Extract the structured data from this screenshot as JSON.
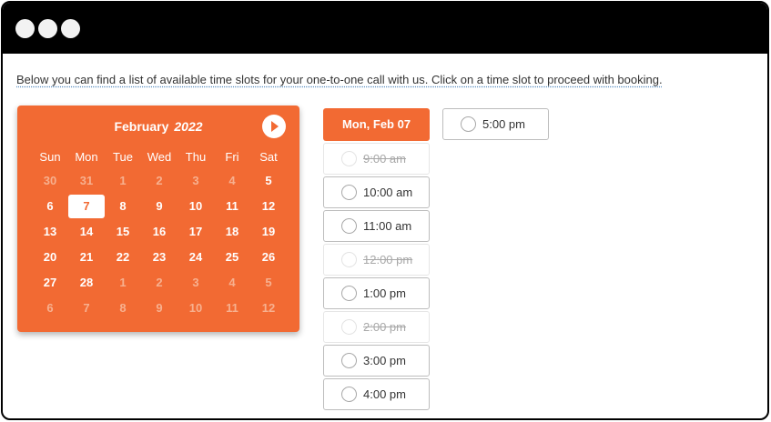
{
  "intro_text": "Below you can find a list of available time slots for your one-to-one call with us. Click on a time slot to proceed with booking.",
  "colors": {
    "accent": "#f26a33",
    "titlebar": "#000000"
  },
  "calendar": {
    "month": "February",
    "year": "2022",
    "next_icon": "chevron-right-icon",
    "weekdays": [
      "Sun",
      "Mon",
      "Tue",
      "Wed",
      "Thu",
      "Fri",
      "Sat"
    ],
    "weeks": [
      [
        {
          "d": "30",
          "o": true
        },
        {
          "d": "31",
          "o": true
        },
        {
          "d": "1",
          "o": true
        },
        {
          "d": "2",
          "o": true
        },
        {
          "d": "3",
          "o": true
        },
        {
          "d": "4",
          "o": true
        },
        {
          "d": "5",
          "o": false
        }
      ],
      [
        {
          "d": "6",
          "o": false
        },
        {
          "d": "7",
          "o": false,
          "sel": true
        },
        {
          "d": "8",
          "o": false
        },
        {
          "d": "9",
          "o": false
        },
        {
          "d": "10",
          "o": false
        },
        {
          "d": "11",
          "o": false
        },
        {
          "d": "12",
          "o": false
        }
      ],
      [
        {
          "d": "13",
          "o": false
        },
        {
          "d": "14",
          "o": false
        },
        {
          "d": "15",
          "o": false
        },
        {
          "d": "16",
          "o": false
        },
        {
          "d": "17",
          "o": false
        },
        {
          "d": "18",
          "o": false
        },
        {
          "d": "19",
          "o": false
        }
      ],
      [
        {
          "d": "20",
          "o": false
        },
        {
          "d": "21",
          "o": false
        },
        {
          "d": "22",
          "o": false
        },
        {
          "d": "23",
          "o": false
        },
        {
          "d": "24",
          "o": false
        },
        {
          "d": "25",
          "o": false
        },
        {
          "d": "26",
          "o": false
        }
      ],
      [
        {
          "d": "27",
          "o": false
        },
        {
          "d": "28",
          "o": false
        },
        {
          "d": "1",
          "o": true
        },
        {
          "d": "2",
          "o": true
        },
        {
          "d": "3",
          "o": true
        },
        {
          "d": "4",
          "o": true
        },
        {
          "d": "5",
          "o": true
        }
      ],
      [
        {
          "d": "6",
          "o": true
        },
        {
          "d": "7",
          "o": true
        },
        {
          "d": "8",
          "o": true
        },
        {
          "d": "9",
          "o": true
        },
        {
          "d": "10",
          "o": true
        },
        {
          "d": "11",
          "o": true
        },
        {
          "d": "12",
          "o": true
        }
      ]
    ]
  },
  "slots": {
    "date_label": "Mon, Feb 07",
    "column1": [
      {
        "time": "9:00 am",
        "available": false
      },
      {
        "time": "10:00 am",
        "available": true
      },
      {
        "time": "11:00 am",
        "available": true
      },
      {
        "time": "12:00 pm",
        "available": false
      },
      {
        "time": "1:00 pm",
        "available": true
      },
      {
        "time": "2:00 pm",
        "available": false
      },
      {
        "time": "3:00 pm",
        "available": true
      },
      {
        "time": "4:00 pm",
        "available": true
      }
    ],
    "column2": [
      {
        "time": "5:00 pm",
        "available": true
      }
    ]
  }
}
